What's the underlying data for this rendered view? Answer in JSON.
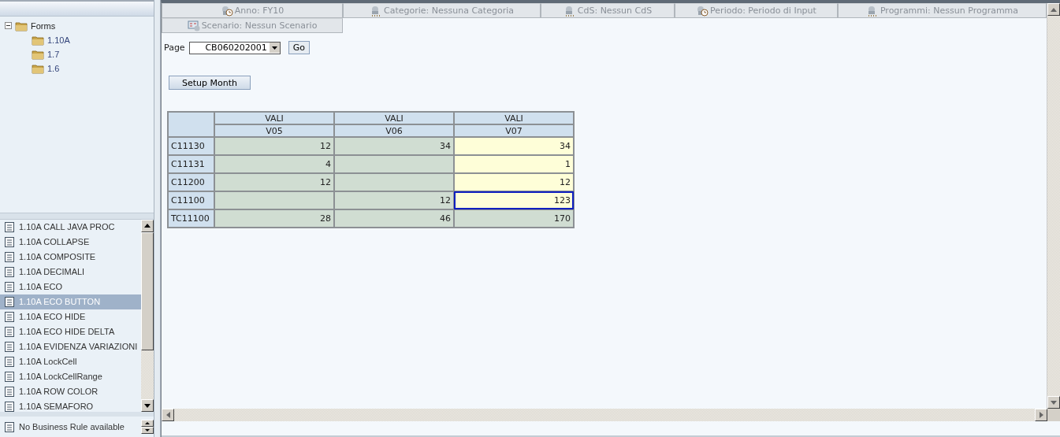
{
  "tree": {
    "label": "Forms",
    "expanded": true,
    "children": [
      {
        "label": "1.10A"
      },
      {
        "label": "1.7"
      },
      {
        "label": "1.6"
      }
    ]
  },
  "forms_list": [
    {
      "label": "1.10A CALL JAVA PROC",
      "selected": false
    },
    {
      "label": "1.10A COLLAPSE",
      "selected": false
    },
    {
      "label": "1.10A COMPOSITE",
      "selected": false
    },
    {
      "label": "1.10A DECIMALI",
      "selected": false
    },
    {
      "label": "1.10A ECO",
      "selected": false
    },
    {
      "label": "1.10A ECO BUTTON",
      "selected": true
    },
    {
      "label": "1.10A ECO HIDE",
      "selected": false
    },
    {
      "label": "1.10A ECO HIDE DELTA",
      "selected": false
    },
    {
      "label": "1.10A EVIDENZA VARIAZIONI",
      "selected": false
    },
    {
      "label": "1.10A LockCell",
      "selected": false
    },
    {
      "label": "1.10A LockCellRange",
      "selected": false
    },
    {
      "label": "1.10A ROW COLOR",
      "selected": false
    },
    {
      "label": "1.10A SEMAFORO",
      "selected": false
    }
  ],
  "business_rules": [
    "No Business Rule available"
  ],
  "pov": [
    {
      "kind": "time",
      "label": "Anno: FY10"
    },
    {
      "kind": "member",
      "label": "Categorie: Nessuna Categoria"
    },
    {
      "kind": "member",
      "label": "CdS: Nessun CdS"
    },
    {
      "kind": "time",
      "label": "Periodo: Periodo di Input"
    },
    {
      "kind": "member",
      "label": "Programmi: Nessun Programma"
    },
    {
      "kind": "scenario",
      "label": "Scenario: Nessun Scenario"
    }
  ],
  "page": {
    "label": "Page",
    "value": "CB060202001",
    "go": "Go"
  },
  "setup_button": "Setup Month",
  "grid": {
    "columns": [
      {
        "top": "VALI",
        "bottom": "V05"
      },
      {
        "top": "VALI",
        "bottom": "V06"
      },
      {
        "top": "VALI",
        "bottom": "V07"
      }
    ],
    "rows": [
      {
        "label": "C11130",
        "cells": [
          {
            "value": "12",
            "kind": "locked",
            "selected": false
          },
          {
            "value": "34",
            "kind": "locked",
            "selected": false
          },
          {
            "value": "34",
            "kind": "input",
            "selected": false
          }
        ]
      },
      {
        "label": "C11131",
        "cells": [
          {
            "value": "4",
            "kind": "locked",
            "selected": false
          },
          {
            "kind": "locked",
            "selected": false
          },
          {
            "value": "1",
            "kind": "input",
            "selected": false
          }
        ]
      },
      {
        "label": "C11200",
        "cells": [
          {
            "value": "12",
            "kind": "locked",
            "selected": false
          },
          {
            "kind": "locked",
            "selected": false
          },
          {
            "value": "12",
            "kind": "input",
            "selected": false
          }
        ]
      },
      {
        "label": "C11100",
        "cells": [
          {
            "kind": "locked",
            "selected": false
          },
          {
            "value": "12",
            "kind": "locked",
            "selected": false
          },
          {
            "value": "123",
            "kind": "input",
            "selected": true
          }
        ]
      },
      {
        "label": "TC11100",
        "cells": [
          {
            "value": "28",
            "kind": "locked",
            "selected": false
          },
          {
            "value": "46",
            "kind": "locked",
            "selected": false
          },
          {
            "value": "170",
            "kind": "locked",
            "selected": false
          }
        ]
      }
    ]
  }
}
